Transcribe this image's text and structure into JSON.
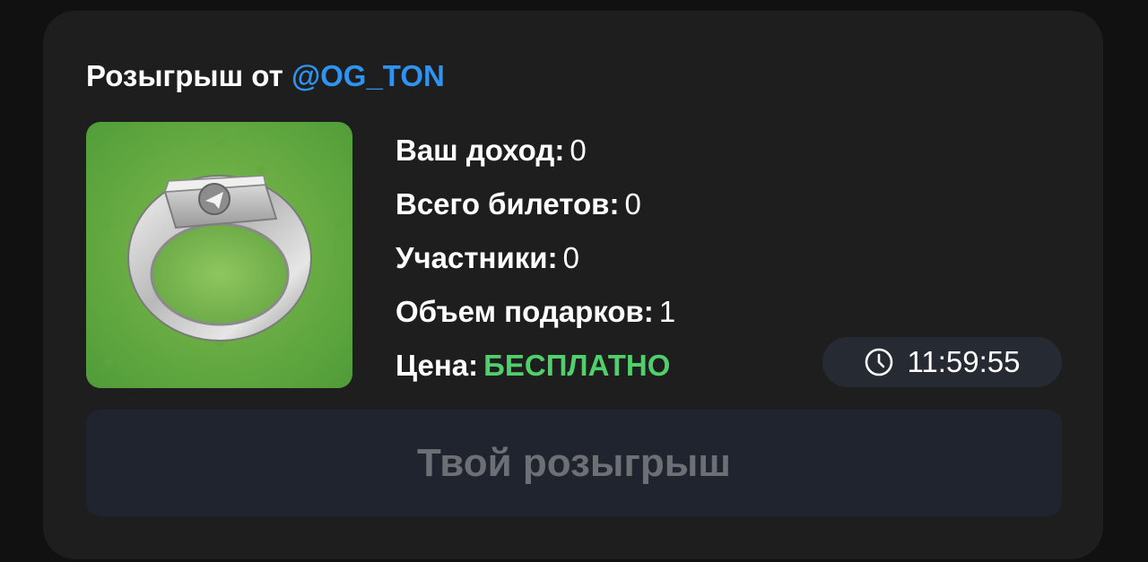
{
  "giveaway": {
    "title_prefix": "Розыгрыш от",
    "channel_handle": "@OG_TON",
    "gift_icon": "signet-ring-gift-icon"
  },
  "stats": {
    "income_label": "Ваш доход:",
    "income_value": "0",
    "tickets_label": "Всего билетов:",
    "tickets_value": "0",
    "participants_label": "Участники:",
    "participants_value": "0",
    "gifts_label": "Объем подарков:",
    "gifts_value": "1",
    "price_label": "Цена:",
    "price_value": "БЕСПЛАТНО"
  },
  "timer": {
    "icon": "clock-icon",
    "value": "11:59:55"
  },
  "action": {
    "label": "Твой розыгрыш"
  },
  "colors": {
    "background": "#111111",
    "card": "#1e1e1e",
    "link": "#2f93ef",
    "free": "#4fd06b",
    "timer_bg": "#262b33",
    "button_bg": "#1f242e",
    "button_text": "#6c6f74"
  }
}
